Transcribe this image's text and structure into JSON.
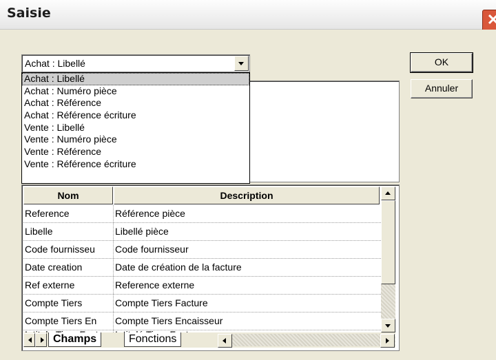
{
  "window": {
    "title": "Saisie",
    "close_glyph": "✕"
  },
  "combo": {
    "value": "Achat : Libellé"
  },
  "dropdown": {
    "items": [
      "Achat : Libellé",
      "Achat : Numéro pièce",
      "Achat : Référence",
      "Achat : Référence écriture",
      "Vente : Libellé",
      "Vente : Numéro pièce",
      "Vente : Référence",
      "Vente : Référence écriture"
    ],
    "selected_index": 0
  },
  "buttons": {
    "ok": "OK",
    "cancel": "Annuler"
  },
  "grid": {
    "headers": [
      "Nom",
      "Description"
    ],
    "rows": [
      [
        "Reference",
        "Référence pièce"
      ],
      [
        "Libelle",
        "Libellé pièce"
      ],
      [
        "Code fournisseu",
        "Code fournisseur"
      ],
      [
        "Date creation",
        "Date de création de la facture"
      ],
      [
        "Ref externe",
        "Reference externe"
      ],
      [
        "Compte Tiers",
        "Compte Tiers Facture"
      ],
      [
        "Compte Tiers En",
        "Compte Tiers Encaisseur"
      ],
      [
        "Intitule Tiers Fact",
        "Intitulé Tiers Facture"
      ]
    ]
  },
  "tabs": [
    "Champs",
    "Fonctions"
  ]
}
